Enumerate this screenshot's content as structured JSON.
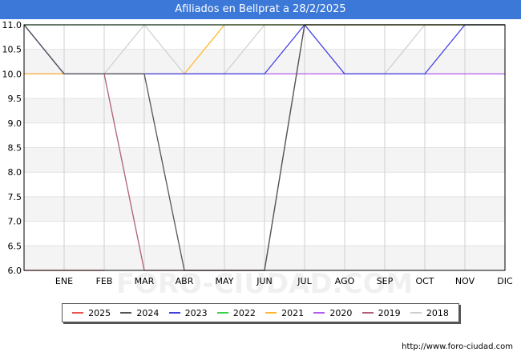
{
  "chart_data": {
    "type": "line",
    "title": "Afiliados en Bellprat a 28/2/2025",
    "categories": [
      "",
      "ENE",
      "FEB",
      "MAR",
      "ABR",
      "MAY",
      "JUN",
      "JUL",
      "AGO",
      "SEP",
      "OCT",
      "NOV",
      "DIC"
    ],
    "y_ticks": [
      "11.0",
      "10.5",
      "10.0",
      "9.5",
      "9.0",
      "8.5",
      "8.0",
      "7.5",
      "7.0",
      "6.5",
      "6.0"
    ],
    "ylim": [
      6,
      11
    ],
    "grid": true,
    "legend_position": "bottom",
    "watermark": "FORO-CIUDAD.COM",
    "series": [
      {
        "name": "2025",
        "color": "#e8534f",
        "values": [
          6,
          6,
          6
        ]
      },
      {
        "name": "2024",
        "color": "#555555",
        "values": [
          11,
          10,
          10,
          10,
          6,
          6,
          6,
          11,
          11,
          11,
          11,
          11,
          11
        ]
      },
      {
        "name": "2023",
        "color": "#4040e0",
        "values": [
          11,
          10,
          10,
          10,
          10,
          10,
          10,
          11,
          10,
          10,
          10,
          11,
          11
        ]
      },
      {
        "name": "2022",
        "color": "#3cd24a",
        "values": [
          11,
          11,
          11,
          11,
          11,
          11,
          11,
          11,
          11,
          11,
          11,
          11,
          11
        ]
      },
      {
        "name": "2021",
        "color": "#ffb830",
        "values": [
          10,
          10,
          10,
          10,
          10,
          11,
          11,
          11,
          11,
          11,
          11,
          11,
          11
        ]
      },
      {
        "name": "2020",
        "color": "#b05ee8",
        "values": [
          10,
          10,
          10,
          10,
          10,
          10,
          10,
          10,
          10,
          10,
          10,
          10,
          10
        ]
      },
      {
        "name": "2019",
        "color": "#b06070",
        "values": [
          11,
          10,
          10,
          6,
          6,
          6,
          6,
          11,
          11,
          11,
          11,
          11,
          11
        ]
      },
      {
        "name": "2018",
        "color": "#d0d0d0",
        "values": [
          11,
          10,
          10,
          11,
          10,
          10,
          11,
          11,
          10,
          10,
          11,
          11,
          11
        ]
      }
    ]
  },
  "source_url": "http://www.foro-ciudad.com"
}
